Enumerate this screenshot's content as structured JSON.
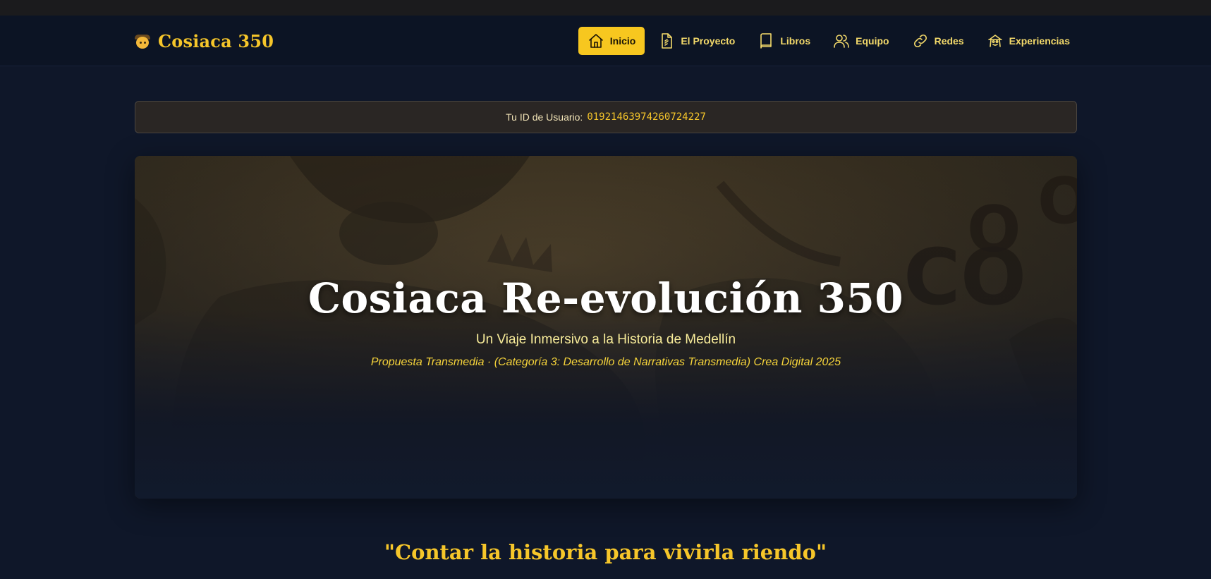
{
  "brand": {
    "title": "Cosiaca 350",
    "icon": "cowboy-face-icon"
  },
  "nav": {
    "items": [
      {
        "label": "Inicio",
        "icon": "home-icon",
        "active": true
      },
      {
        "label": "El Proyecto",
        "icon": "document-icon",
        "active": false
      },
      {
        "label": "Libros",
        "icon": "book-icon",
        "active": false
      },
      {
        "label": "Equipo",
        "icon": "users-icon",
        "active": false
      },
      {
        "label": "Redes",
        "icon": "link-icon",
        "active": false
      },
      {
        "label": "Experiencias",
        "icon": "experience-icon",
        "active": false
      }
    ]
  },
  "user": {
    "id_label": "Tu ID de Usuario:",
    "id_value": "01921463974260724227"
  },
  "hero": {
    "title": "Cosiaca Re-evolución 350",
    "subtitle": "Un Viaje Inmersivo a la Historia de Medellín",
    "tagline": "Propuesta Transmedia · (Categoría 3: Desarrollo de Narrativas Transmedia) Crea Digital 2025"
  },
  "quote": "\"Contar la historia para vivirla riendo\"",
  "colors": {
    "accent": "#f7c71f",
    "background": "#0f1729",
    "navbar": "#0c1424",
    "nav_text": "#f3d96a"
  }
}
